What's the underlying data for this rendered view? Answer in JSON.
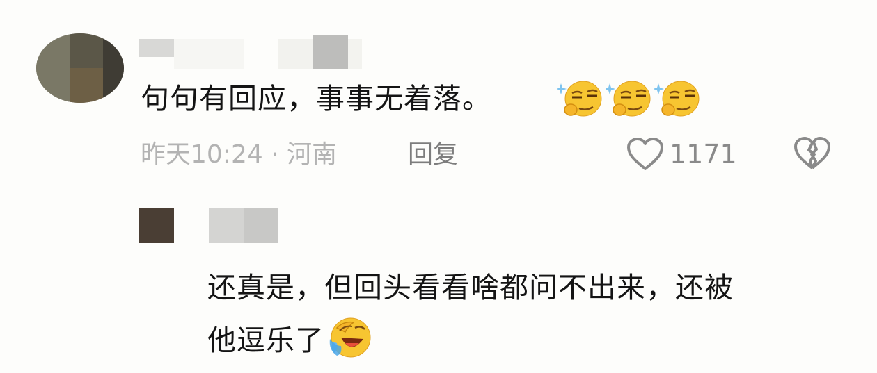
{
  "comment": {
    "text": "句句有回应，事事无着落。",
    "emojis": [
      "smug-face-icon",
      "smug-face-icon",
      "smug-face-icon"
    ],
    "time_location": "昨天10:24 · 河南",
    "reply_label": "回复",
    "like_count": "1171"
  },
  "reply": {
    "line1": "还真是，但回头看看啥都问不出来，还被",
    "line2": "他逗乐了",
    "emoji": "laugh-cry-face-icon"
  },
  "colors": {
    "text_primary": "#141414",
    "text_meta": "#b3b3b3",
    "text_action": "#7d7d7d",
    "emoji_yellow": "#f7c531"
  }
}
